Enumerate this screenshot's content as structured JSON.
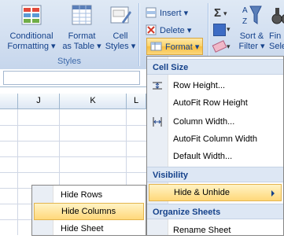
{
  "ribbon": {
    "styles_group": {
      "label": "Styles",
      "conditional_formatting": {
        "line1": "Conditional",
        "line2": "Formatting ▾"
      },
      "format_as_table": {
        "line1": "Format",
        "line2": "as Table ▾"
      },
      "cell_styles": {
        "line1": "Cell",
        "line2": "Styles ▾"
      }
    },
    "cells_group": {
      "insert_label": "Insert ▾",
      "delete_label": "Delete ▾",
      "format_label": "Format ▾"
    },
    "editing_group": {
      "sort_filter": {
        "line1": "Sort &",
        "line2": "Filter ▾"
      },
      "find_select": {
        "line1": "Fin",
        "line2": "Sele"
      }
    }
  },
  "sheet": {
    "columns": [
      "J",
      "K",
      "L"
    ]
  },
  "format_menu": {
    "sections": {
      "cell_size": "Cell Size",
      "visibility": "Visibility",
      "organize_sheets": "Organize Sheets"
    },
    "items": {
      "row_height": "Row Height...",
      "autofit_row_height": "AutoFit Row Height",
      "column_width": "Column Width...",
      "autofit_column_width": "AutoFit Column Width",
      "default_width": "Default Width...",
      "hide_unhide": "Hide & Unhide",
      "rename_sheet": "Rename Sheet"
    }
  },
  "hide_submenu": {
    "items": [
      "Hide Rows",
      "Hide Columns",
      "Hide Sheet"
    ],
    "selected": "Hide Columns"
  },
  "colors": {
    "ribbon_text": "#15428b",
    "highlight": "#ffd87a",
    "ribbon_bg": "#d1def0"
  }
}
